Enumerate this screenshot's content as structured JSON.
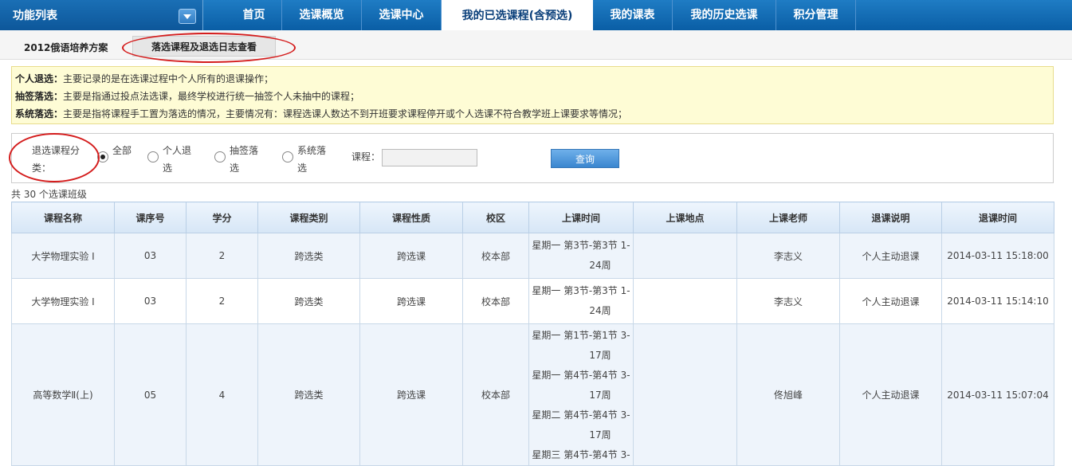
{
  "header": {
    "function_list_label": "功能列表",
    "tabs": [
      {
        "label": "首页",
        "width": 70
      },
      {
        "label": "选课概览",
        "width": 100
      },
      {
        "label": "选课中心",
        "width": 100
      },
      {
        "label": "我的已选课程(含预选)",
        "width": 190,
        "active": true
      },
      {
        "label": "我的课表",
        "width": 100
      },
      {
        "label": "我的历史选课",
        "width": 130
      },
      {
        "label": "积分管理",
        "width": 100
      }
    ]
  },
  "subtabs": {
    "plan": "2012俄语培养方案",
    "log": "落选课程及退选日志查看"
  },
  "info": [
    {
      "term": "个人退选：",
      "text": "主要记录的是在选课过程中个人所有的退课操作；"
    },
    {
      "term": "抽签落选：",
      "text": "主要是指通过投点法选课，最终学校进行统一抽签个人未抽中的课程；"
    },
    {
      "term": "系统落选：",
      "text": "主要是指将课程手工置为落选的情况，主要情况有：课程选课人数达不到开班要求课程停开或个人选课不符合教学班上课要求等情况；"
    }
  ],
  "filter": {
    "label": "退选课程分类：",
    "options": [
      {
        "label": "全部",
        "checked": true
      },
      {
        "label": "个人退选",
        "checked": false
      },
      {
        "label": "抽签落选",
        "checked": false
      },
      {
        "label": "系统落选",
        "checked": false
      }
    ],
    "course_label": "课程：",
    "course_value": "",
    "query_button": "查询"
  },
  "total_text": "共 30 个选课班级",
  "table": {
    "columns": [
      "课程名称",
      "课序号",
      "学分",
      "课程类别",
      "课程性质",
      "校区",
      "上课时间",
      "上课地点",
      "上课老师",
      "退课说明",
      "退课时间"
    ],
    "rows": [
      {
        "name": "大学物理实验 I",
        "seq": "03",
        "credit": "2",
        "category": "跨选类",
        "nature": "跨选课",
        "campus": "校本部",
        "time": [
          "星期一  第3节-第3节  1-",
          "24周"
        ],
        "place": "",
        "teacher": "李志义",
        "note": "个人主动退课",
        "drop_time": "2014-03-11 15:18:00"
      },
      {
        "name": "大学物理实验 I",
        "seq": "03",
        "credit": "2",
        "category": "跨选类",
        "nature": "跨选课",
        "campus": "校本部",
        "time": [
          "星期一  第3节-第3节  1-",
          "24周"
        ],
        "place": "",
        "teacher": "李志义",
        "note": "个人主动退课",
        "drop_time": "2014-03-11 15:14:10"
      },
      {
        "name": "高等数学Ⅱ(上)",
        "seq": "05",
        "credit": "4",
        "category": "跨选类",
        "nature": "跨选课",
        "campus": "校本部",
        "time": [
          "星期一  第1节-第1节  3-",
          "17周",
          "星期一  第4节-第4节  3-",
          "17周",
          "星期二  第4节-第4节  3-",
          "17周",
          "星期三  第4节-第4节  3-"
        ],
        "place": "",
        "teacher": "佟旭峰",
        "note": "个人主动退课",
        "drop_time": "2014-03-11 15:07:04"
      }
    ]
  }
}
